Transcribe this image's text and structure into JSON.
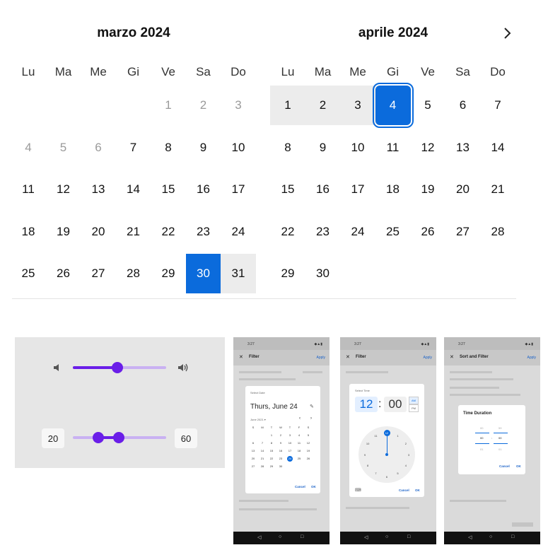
{
  "calendar": {
    "months": [
      {
        "title": "marzo 2024",
        "lead_blanks": 4,
        "days": 31
      },
      {
        "title": "aprile 2024",
        "lead_blanks": 0,
        "days": 30
      }
    ],
    "weekdays": [
      "Lu",
      "Ma",
      "Me",
      "Gi",
      "Ve",
      "Sa",
      "Do"
    ],
    "selected_start": {
      "month": 0,
      "day": 30
    },
    "range_days_month0": [
      31
    ],
    "range_days_month1": [
      1,
      2,
      3
    ],
    "focused_end": {
      "month": 1,
      "day": 4
    },
    "muted_days_month0": [
      1,
      2,
      3,
      4,
      5,
      6
    ],
    "next_icon": "chevron-right-icon",
    "accent": "#0b6bdc"
  },
  "sliders": {
    "volume": {
      "value": 0.48,
      "icon_low": "volume-low-icon",
      "icon_high": "volume-high-icon"
    },
    "range": {
      "min_label": "20",
      "max_label": "60",
      "low": 0.27,
      "high": 0.49
    },
    "accent": "#6a1ee8",
    "track_color": "#c9b1f2"
  },
  "phones": [
    {
      "status_time": "3:27",
      "appbar_title": "Filter",
      "apply_label": "Apply",
      "dialog_caption": "Select Date",
      "date_headline": "Thurs, June 24",
      "month_label": "June 2021",
      "mini_weekdays": [
        "S",
        "M",
        "T",
        "W",
        "T",
        "F",
        "S"
      ],
      "mini_days": [
        "",
        "",
        "1",
        "2",
        "3",
        "4",
        "5",
        "6",
        "7",
        "8",
        "9",
        "10",
        "11",
        "12",
        "13",
        "14",
        "15",
        "16",
        "17",
        "18",
        "19",
        "20",
        "21",
        "22",
        "23",
        "24",
        "25",
        "26",
        "27",
        "28",
        "29",
        "30"
      ],
      "mini_selected": "24",
      "cancel_label": "Cancel",
      "ok_label": "OK"
    },
    {
      "status_time": "3:27",
      "appbar_title": "Filter",
      "apply_label": "Apply",
      "dialog_caption": "Select Time",
      "hour": "12",
      "minute": "00",
      "am_label": "AM",
      "pm_label": "PM",
      "clock_numbers": [
        "12",
        "1",
        "2",
        "3",
        "4",
        "5",
        "6",
        "7",
        "8",
        "9",
        "10",
        "11"
      ],
      "cancel_label": "Cancel",
      "ok_label": "OK"
    },
    {
      "status_time": "3:27",
      "appbar_title": "Sort and Filter",
      "apply_label": "Apply",
      "dialog_title": "Time Duration",
      "row_prev": [
        "00",
        "59"
      ],
      "row_current": [
        "00",
        "00"
      ],
      "row_next": [
        "01",
        "01"
      ],
      "cancel_label": "Cancel",
      "ok_label": "OK"
    }
  ]
}
